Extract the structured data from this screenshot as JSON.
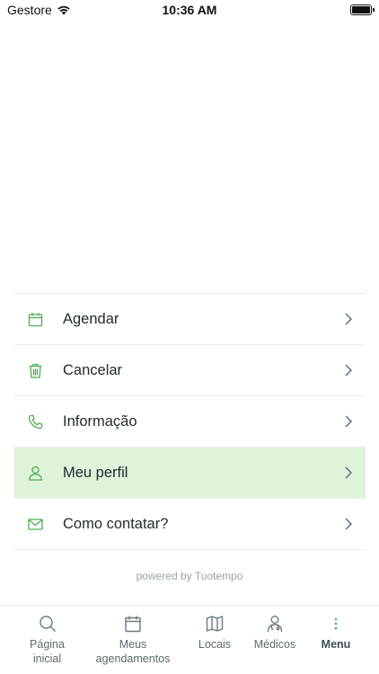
{
  "status_bar": {
    "carrier": "Gestore",
    "time": "10:36 AM",
    "battery_level": 1.0
  },
  "accent_color": "#4caf50",
  "active_row_color": "#dff2da",
  "menu": {
    "items": [
      {
        "label": "Agendar",
        "icon": "calendar-icon",
        "active": false
      },
      {
        "label": "Cancelar",
        "icon": "trash-icon",
        "active": false
      },
      {
        "label": "Informação",
        "icon": "phone-icon",
        "active": false
      },
      {
        "label": "Meu perfil",
        "icon": "user-icon",
        "active": true
      },
      {
        "label": "Como contatar?",
        "icon": "mail-icon",
        "active": false
      }
    ]
  },
  "footer": {
    "powered_by": "powered by Tuotempo"
  },
  "tab_bar": {
    "tabs": [
      {
        "label": "Página inicial",
        "icon": "search-icon",
        "active": false
      },
      {
        "label": "Meus agendamentos",
        "icon": "calendar-icon",
        "active": false
      },
      {
        "label": "Locais",
        "icon": "map-icon",
        "active": false
      },
      {
        "label": "Médicos",
        "icon": "doctor-icon",
        "active": false
      },
      {
        "label": "Menu",
        "icon": "more-vertical-icon",
        "active": true
      }
    ]
  }
}
